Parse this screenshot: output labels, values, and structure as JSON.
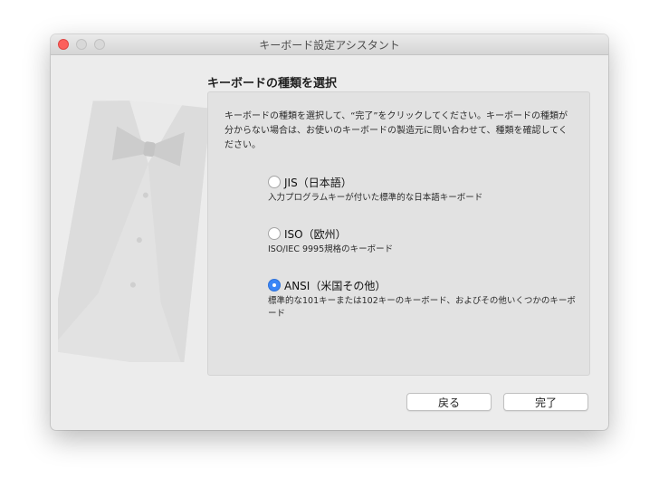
{
  "window": {
    "title": "キーボード設定アシスタント"
  },
  "page": {
    "heading": "キーボードの種類を選択"
  },
  "description": "キーボードの種類を選択して、“完了”をクリックしてください。キーボードの種類が分からない場合は、お使いのキーボードの製造元に問い合わせて、種類を確認してください。",
  "options": [
    {
      "label": "JIS（日本語）",
      "description": "入力プログラムキーが付いた標準的な日本語キーボード",
      "selected": false
    },
    {
      "label": "ISO（欧州）",
      "description": "ISO/IEC 9995規格のキーボード",
      "selected": false
    },
    {
      "label": "ANSI（米国その他）",
      "description": "標準的な101キーまたは102キーのキーボード、およびその他いくつかのキーボード",
      "selected": true
    }
  ],
  "buttons": {
    "back": "戻る",
    "done": "完了"
  },
  "colors": {
    "accent": "#3a86f7",
    "close": "#fc605c"
  }
}
